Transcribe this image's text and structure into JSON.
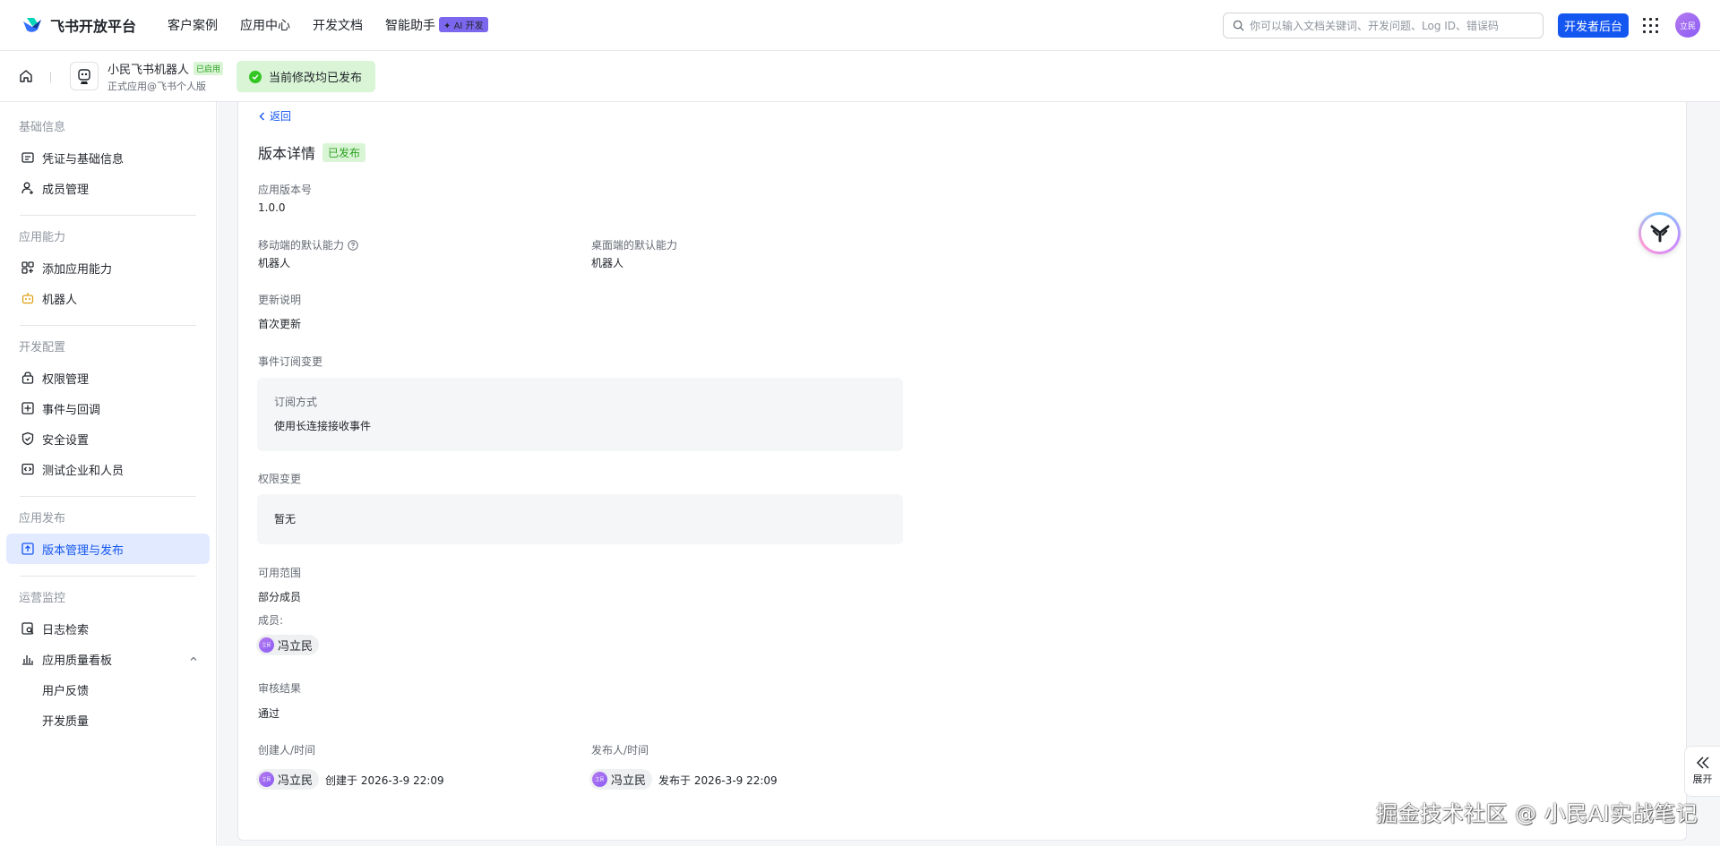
{
  "header": {
    "brand": "飞书开放平台",
    "nav": [
      "客户案例",
      "应用中心",
      "开发文档",
      "智能助手"
    ],
    "ai_badge": "AI 开发",
    "search_placeholder": "你可以输入文档关键词、开发问题、Log ID、错误码",
    "dev_console": "开发者后台",
    "avatar": "立民"
  },
  "appbar": {
    "app_name": "小民飞书机器人",
    "enabled_tag": "已启用",
    "app_sub": "正式应用@飞书个人版",
    "publish_status": "当前修改均已发布"
  },
  "sidebar": {
    "groups": [
      {
        "title": "基础信息",
        "items": [
          "凭证与基础信息",
          "成员管理"
        ]
      },
      {
        "title": "应用能力",
        "items": [
          "添加应用能力",
          "机器人"
        ]
      },
      {
        "title": "开发配置",
        "items": [
          "权限管理",
          "事件与回调",
          "安全设置",
          "测试企业和人员"
        ]
      },
      {
        "title": "应用发布",
        "items": [
          "版本管理与发布"
        ]
      },
      {
        "title": "运营监控",
        "items": [
          "日志检索",
          "应用质量看板",
          "用户反馈",
          "开发质量"
        ]
      }
    ]
  },
  "main": {
    "back": "返回",
    "title": "版本详情",
    "status_tag": "已发布",
    "version_label": "应用版本号",
    "version_value": "1.0.0",
    "mobile_label": "移动端的默认能力",
    "mobile_value": "机器人",
    "desktop_label": "桌面端的默认能力",
    "desktop_value": "机器人",
    "notes_label": "更新说明",
    "notes_value": "首次更新",
    "event_label": "事件订阅变更",
    "event_sub_label": "订阅方式",
    "event_sub_value": "使用长连接接收事件",
    "perm_label": "权限变更",
    "perm_value": "暂无",
    "scope_label": "可用范围",
    "scope_value": "部分成员",
    "members_label": "成员:",
    "member_name": "冯立民",
    "review_label": "审核结果",
    "review_value": "通过",
    "creator_label": "创建人/时间",
    "creator_name": "冯立民",
    "created_at": "创建于 2026-3-9 22:09",
    "publisher_label": "发布人/时间",
    "publisher_name": "冯立民",
    "published_at": "发布于 2026-3-9 22:09",
    "chip_avatar": "立民"
  },
  "floating": {
    "expand": "展开",
    "watermark": "掘金技术社区 @ 小民AI实战笔记"
  }
}
